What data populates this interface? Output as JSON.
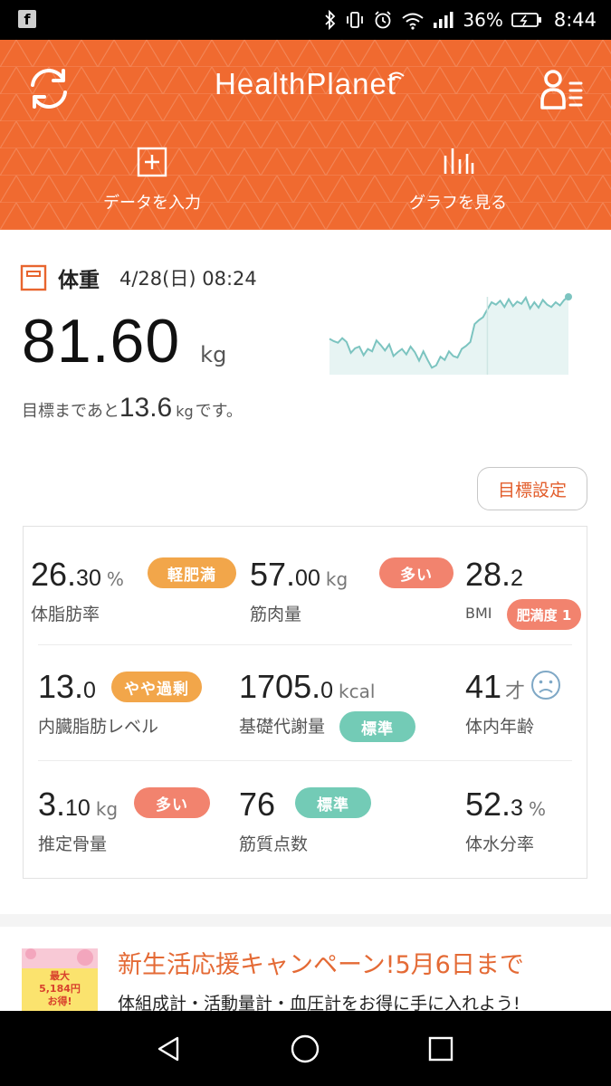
{
  "status_bar": {
    "battery_percent": "36%",
    "time": "8:44",
    "icons": [
      "facebook-notification-icon",
      "bluetooth-icon",
      "vibrate-icon",
      "alarm-icon",
      "wifi-icon",
      "signal-icon",
      "battery-icon"
    ]
  },
  "header": {
    "logo": "HealthPlanet",
    "bg_color": "#f06a30",
    "actions": [
      {
        "label": "データを入力",
        "icon": "plus-square-icon"
      },
      {
        "label": "グラフを見る",
        "icon": "bar-graph-icon"
      }
    ]
  },
  "weight": {
    "title": "体重",
    "date": "4/28(日) 08:24",
    "value": "81.60",
    "unit": "kg",
    "goal_prefix": "目標まであと",
    "goal_value": "13.6",
    "goal_unit": "kg",
    "goal_suffix": "です。",
    "trend": [
      0.46,
      0.43,
      0.41,
      0.47,
      0.42,
      0.28,
      0.34,
      0.36,
      0.25,
      0.33,
      0.3,
      0.44,
      0.38,
      0.31,
      0.39,
      0.24,
      0.29,
      0.33,
      0.26,
      0.36,
      0.29,
      0.18,
      0.3,
      0.19,
      0.09,
      0.12,
      0.23,
      0.19,
      0.3,
      0.24,
      0.22,
      0.33,
      0.37,
      0.42,
      0.65,
      0.7,
      0.74,
      0.84,
      0.93,
      0.9,
      0.95,
      0.87,
      0.97,
      0.88,
      0.94,
      0.91,
      0.99,
      0.85,
      0.93,
      0.86,
      0.96,
      0.9,
      0.87,
      0.93,
      0.89,
      0.96,
      1.0
    ]
  },
  "goal_button": "目標設定",
  "metrics": {
    "body_fat": {
      "int": "26.",
      "dec": "30",
      "unit": "%",
      "label": "体脂肪率",
      "badge": "軽肥満"
    },
    "muscle": {
      "int": "57.",
      "dec": "00",
      "unit": "kg",
      "label": "筋肉量",
      "badge": "多い"
    },
    "bmi": {
      "int": "28.",
      "dec": "2",
      "unit": "",
      "label": "BMI",
      "badge": "肥満度 1"
    },
    "visceral_fat": {
      "int": "13.",
      "dec": "0",
      "unit": "",
      "label": "内臓脂肪レベル",
      "badge": "やや過剰"
    },
    "bmr": {
      "int": "1705.",
      "dec": "0",
      "unit": "kcal",
      "label": "基礎代謝量",
      "badge": "標準"
    },
    "body_age": {
      "int": "41",
      "dec": "",
      "unit": "才",
      "label": "体内年齢",
      "icon": "sad-face-icon"
    },
    "bone_mass": {
      "int": "3.",
      "dec": "10",
      "unit": "kg",
      "label": "推定骨量",
      "badge": "多い"
    },
    "muscle_score": {
      "int": "76",
      "dec": "",
      "unit": "",
      "label": "筋質点数",
      "badge": "標準"
    },
    "body_water": {
      "int": "52.",
      "dec": "3",
      "unit": "%",
      "label": "体水分率"
    }
  },
  "badge_colors": {
    "orange": "#f2a64a",
    "red": "#f2836e",
    "teal": "#73cbb6"
  },
  "campaign": {
    "title": "新生活応援キャンペーン!5月6日まで",
    "subtitle": "体組成計・活動量計・血圧計をお得に手に入れよう!",
    "image_text": [
      "最大",
      "5,184円",
      "お得!"
    ]
  },
  "nav": [
    "back-icon",
    "home-icon",
    "recent-apps-icon"
  ]
}
